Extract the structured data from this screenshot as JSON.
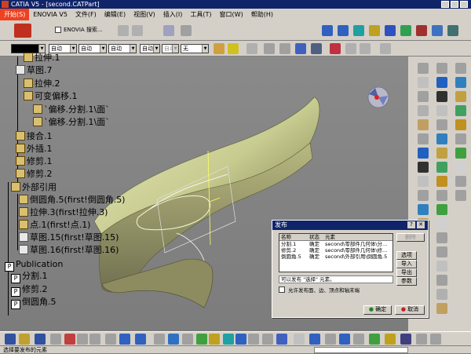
{
  "window": {
    "title": "CATIA V5 - [second.CATPart]"
  },
  "menu": [
    "开始(S)",
    "ENOVIA V5",
    "文件(F)",
    "编辑(E)",
    "视图(V)",
    "插入(I)",
    "工具(T)",
    "窗口(W)",
    "帮助(H)"
  ],
  "toolbar": {
    "enovia_label": "ENOVIA 搜索...",
    "combo1": "",
    "combo2": "自动",
    "combo3": "自动",
    "combo4": "自动",
    "combo5": "自动",
    "combo6": "自动",
    "combo7": "无"
  },
  "tree": [
    {
      "label": "拉伸.1",
      "type": "feat"
    },
    {
      "label": "草图.7",
      "type": "sketch"
    },
    {
      "label": "拉伸.2",
      "type": "feat"
    },
    {
      "label": "可变偏移.1",
      "type": "feat"
    },
    {
      "label": "`偏移.分割.1\\面`",
      "type": "feat"
    },
    {
      "label": "`偏移.分割.1\\面`",
      "type": "feat"
    },
    {
      "label": "接合.1",
      "type": "feat"
    },
    {
      "label": "外插.1",
      "type": "feat"
    },
    {
      "label": "修剪.1",
      "type": "feat"
    },
    {
      "label": "修剪.2",
      "type": "feat"
    },
    {
      "label": "外部引用",
      "type": "feat"
    },
    {
      "label": "倒圆角.5(first!倒圆角.5)",
      "type": "feat"
    },
    {
      "label": "拉伸.3(first!拉伸.3)",
      "type": "feat"
    },
    {
      "label": "点.1(first!点.1)",
      "type": "feat"
    },
    {
      "label": "草图.15(first!草图.15)",
      "type": "sketch"
    },
    {
      "label": "草图.16(first!草图.16)",
      "type": "sketch"
    },
    {
      "label": "Publication",
      "type": "pub"
    },
    {
      "label": "分割.1",
      "type": "pub"
    },
    {
      "label": "修剪.2",
      "type": "pub"
    },
    {
      "label": "倒圆角.5",
      "type": "pub"
    }
  ],
  "dialog": {
    "title": "发布",
    "columns": [
      "名称",
      "状态",
      "元素"
    ],
    "rows": [
      [
        "分割.1",
        "确定",
        "second\\零部件几何体\\分..."
      ],
      [
        "修剪.2",
        "确定",
        "second\\零部件几何体\\修..."
      ],
      [
        "倒圆角.5",
        "确定",
        "second\\外部引用\\倒圆角.5"
      ]
    ],
    "side_buttons": [
      "删除",
      "选项",
      "导入",
      "导出",
      "参数"
    ],
    "hint": "可以发布 \"选择\" 元素。",
    "checkbox_label": "允许发布面、边、顶点和轴末端",
    "ok": "确定",
    "cancel": "取消"
  },
  "status": {
    "text": "选择要发布的元素"
  },
  "colors": {
    "title_bg": "#10246a",
    "accent": "#f04020",
    "surface": "#c8cc90"
  }
}
